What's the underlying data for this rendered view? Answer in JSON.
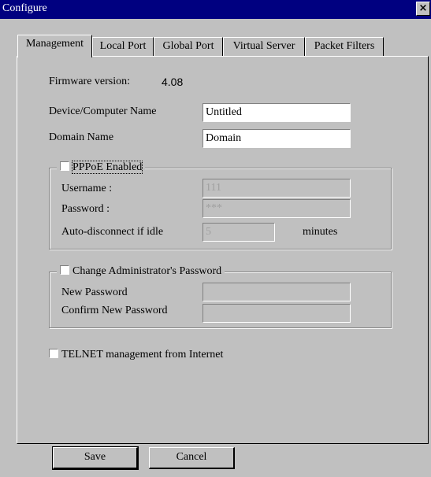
{
  "window": {
    "title": "Configure",
    "close_label": "×"
  },
  "tabs": [
    {
      "label": "Management",
      "active": true
    },
    {
      "label": "Local Port",
      "active": false
    },
    {
      "label": "Global Port",
      "active": false
    },
    {
      "label": "Virtual Server",
      "active": false
    },
    {
      "label": "Packet Filters",
      "active": false
    }
  ],
  "management": {
    "firmware_label": "Firmware version:",
    "firmware_value": "4.08",
    "device_name_label": "Device/Computer Name",
    "device_name_value": "Untitled",
    "domain_label": "Domain Name",
    "domain_value": "Domain"
  },
  "pppoe": {
    "label": "PPPoE Enabled",
    "checked": false,
    "username_label": "Username :",
    "username_value": "111",
    "password_label": "Password :",
    "password_value": "***",
    "autodisconnect_label": "Auto-disconnect if idle",
    "autodisconnect_value": "5",
    "minutes_label": "minutes"
  },
  "admin_password": {
    "label": "Change Administrator's Password",
    "checked": false,
    "new_label": "New Password",
    "new_value": "",
    "confirm_label": "Confirm New Password",
    "confirm_value": ""
  },
  "telnet": {
    "label": "TELNET management from Internet",
    "checked": false
  },
  "buttons": {
    "save": "Save",
    "cancel": "Cancel"
  }
}
